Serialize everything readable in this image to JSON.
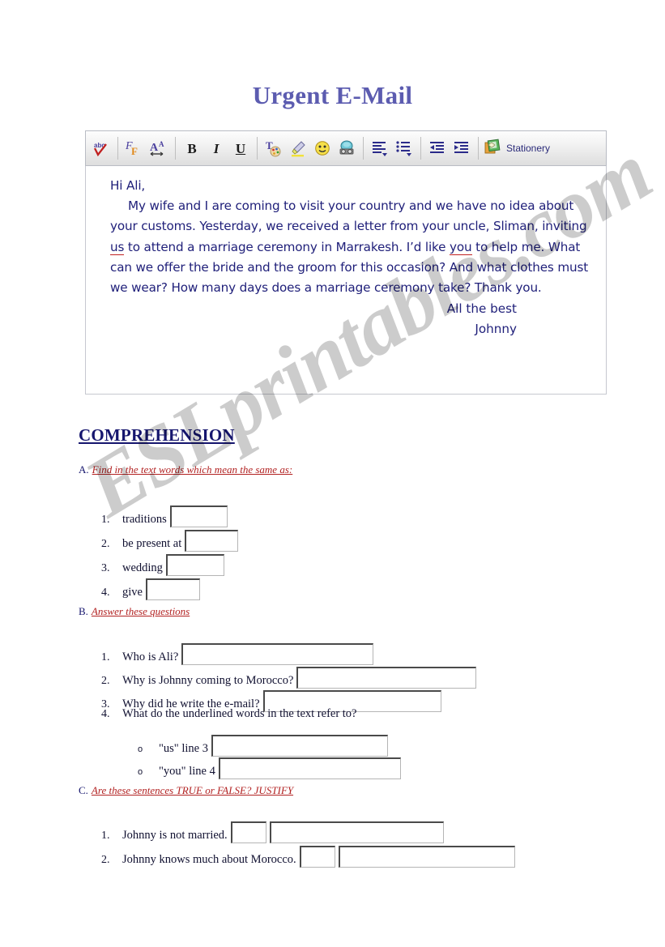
{
  "page": {
    "title": "Urgent E-Mail",
    "watermark": "ESLprintables.com"
  },
  "email": {
    "toolbar": {
      "buttons": [
        {
          "name": "spelling-check-icon",
          "label": "abc"
        },
        {
          "name": "font-icon",
          "label": "F"
        },
        {
          "name": "font-size-icon",
          "label": "A"
        },
        {
          "name": "bold-icon",
          "label": "B"
        },
        {
          "name": "italic-icon",
          "label": "I"
        },
        {
          "name": "underline-icon",
          "label": "U"
        },
        {
          "name": "font-color-icon",
          "label": "T"
        },
        {
          "name": "highlight-icon",
          "label": ""
        },
        {
          "name": "emoticon-icon",
          "label": ""
        },
        {
          "name": "insert-link-icon",
          "label": ""
        },
        {
          "name": "align-icon",
          "label": ""
        },
        {
          "name": "bullet-list-icon",
          "label": ""
        },
        {
          "name": "decrease-indent-icon",
          "label": ""
        },
        {
          "name": "increase-indent-icon",
          "label": ""
        }
      ],
      "stationery_label": "Stationery"
    },
    "greeting": "Hi Ali,",
    "body_pre_us": "My wife and I are coming to visit your country and we have no idea about your customs. Yesterday, we received a letter from your uncle, Sliman, inviting ",
    "underlined_us": "us",
    "body_mid": " to attend a marriage ceremony in Marrakesh. I’d like ",
    "underlined_you": "you",
    "body_post": " to help me. What can we offer the bride and the groom for this occasion? And what clothes must we wear? How many days does a marriage ceremony take? Thank you.",
    "closing": "All the best",
    "signature": "Johnny"
  },
  "worksheet": {
    "heading": "COMPREHENSION",
    "sections": [
      {
        "letter": "A.",
        "title": "Find in the text words which mean the same as:",
        "items": [
          {
            "num": "1.",
            "text": "traditions"
          },
          {
            "num": "2.",
            "text": "be present at"
          },
          {
            "num": "3.",
            "text": "wedding"
          },
          {
            "num": "4.",
            "text": "give"
          }
        ]
      },
      {
        "letter": "B.",
        "title": "Answer these questions",
        "items": [
          {
            "num": "1.",
            "text": "Who is Ali?"
          },
          {
            "num": "2.",
            "text": "Why is Johnny coming to Morocco?"
          },
          {
            "num": "3.",
            "text": "Why did he write the e-mail?"
          },
          {
            "num": "4.",
            "text": "What do the underlined words in the text refer to?"
          }
        ],
        "subitems": [
          {
            "bullet": "o",
            "text": "\"us\" line 3"
          },
          {
            "bullet": "o",
            "text": "\"you\" line 4"
          }
        ]
      },
      {
        "letter": "C.",
        "title": "Are these sentences TRUE or FALSE? JUSTIFY",
        "items": [
          {
            "num": "1.",
            "text": "Johnny is not married."
          },
          {
            "num": "2.",
            "text": "Johnny knows much about Morocco."
          }
        ]
      }
    ]
  },
  "colors": {
    "title": "#5c5cb0",
    "heading": "#16166e",
    "section_title": "#b22222",
    "email_text": "#20207a"
  }
}
